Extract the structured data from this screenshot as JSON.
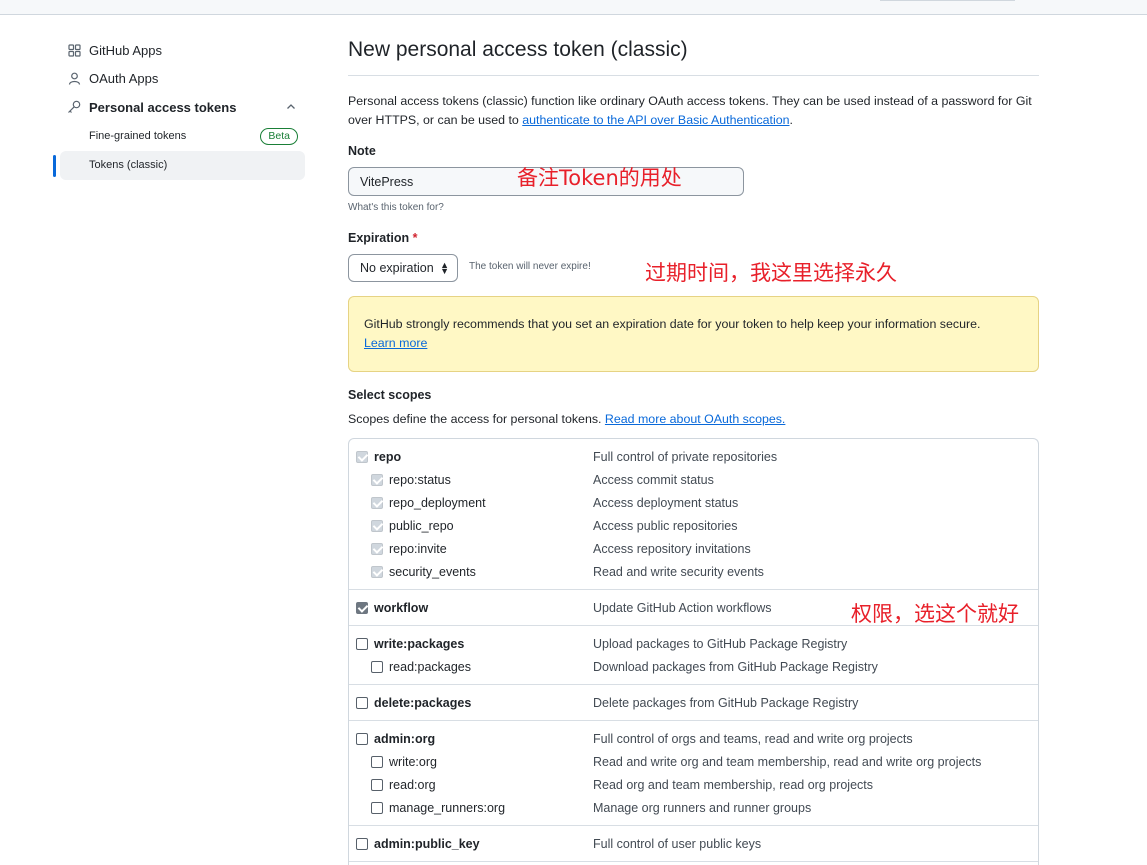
{
  "sidebar": {
    "items": [
      {
        "label": "GitHub Apps",
        "icon": "apps-grid-icon"
      },
      {
        "label": "OAuth Apps",
        "icon": "person-icon"
      },
      {
        "label": "Personal access tokens",
        "icon": "key-icon"
      }
    ],
    "sub_items": [
      {
        "label": "Fine-grained tokens",
        "badge": "Beta"
      },
      {
        "label": "Tokens (classic)",
        "active": true
      }
    ]
  },
  "main": {
    "title": "New personal access token (classic)",
    "desc_text": "Personal access tokens (classic) function like ordinary OAuth access tokens. They can be used instead of a password for Git over HTTPS, or can be used to ",
    "desc_link": "authenticate to the API over Basic Authentication",
    "desc_end": ".",
    "note": {
      "label": "Note",
      "value": "VitePress",
      "hint": "What's this token for?"
    },
    "expiration": {
      "label": "Expiration",
      "required": "*",
      "value": "No expiration",
      "hint": "The token will never expire!"
    },
    "warning": {
      "text": "GitHub strongly recommends that you set an expiration date for your token to help keep your information secure.",
      "link": "Learn more"
    },
    "scopes": {
      "label": "Select scopes",
      "desc": "Scopes define the access for personal tokens. ",
      "desc_link": "Read more about OAuth scopes.",
      "groups": [
        {
          "rows": [
            {
              "name": "repo",
              "desc": "Full control of private repositories",
              "state": "disabled",
              "level": "parent"
            },
            {
              "name": "repo:status",
              "desc": "Access commit status",
              "state": "disabled",
              "level": "child"
            },
            {
              "name": "repo_deployment",
              "desc": "Access deployment status",
              "state": "disabled",
              "level": "child"
            },
            {
              "name": "public_repo",
              "desc": "Access public repositories",
              "state": "disabled",
              "level": "child"
            },
            {
              "name": "repo:invite",
              "desc": "Access repository invitations",
              "state": "disabled",
              "level": "child"
            },
            {
              "name": "security_events",
              "desc": "Read and write security events",
              "state": "disabled",
              "level": "child"
            }
          ]
        },
        {
          "rows": [
            {
              "name": "workflow",
              "desc": "Update GitHub Action workflows",
              "state": "checked",
              "level": "parent"
            }
          ]
        },
        {
          "rows": [
            {
              "name": "write:packages",
              "desc": "Upload packages to GitHub Package Registry",
              "state": "unchecked",
              "level": "parent"
            },
            {
              "name": "read:packages",
              "desc": "Download packages from GitHub Package Registry",
              "state": "unchecked",
              "level": "child"
            }
          ]
        },
        {
          "rows": [
            {
              "name": "delete:packages",
              "desc": "Delete packages from GitHub Package Registry",
              "state": "unchecked",
              "level": "parent"
            }
          ]
        },
        {
          "rows": [
            {
              "name": "admin:org",
              "desc": "Full control of orgs and teams, read and write org projects",
              "state": "unchecked",
              "level": "parent"
            },
            {
              "name": "write:org",
              "desc": "Read and write org and team membership, read and write org projects",
              "state": "unchecked",
              "level": "child"
            },
            {
              "name": "read:org",
              "desc": "Read org and team membership, read org projects",
              "state": "unchecked",
              "level": "child"
            },
            {
              "name": "manage_runners:org",
              "desc": "Manage org runners and runner groups",
              "state": "unchecked",
              "level": "child"
            }
          ]
        },
        {
          "rows": [
            {
              "name": "admin:public_key",
              "desc": "Full control of user public keys",
              "state": "unchecked",
              "level": "parent"
            }
          ]
        }
      ]
    }
  },
  "annotations": {
    "note": "备注Token的用处",
    "expiration": "过期时间，我这里选择永久",
    "scopes": "权限，选这个就好"
  },
  "colors": {
    "accent": "#0969da",
    "annotation": "#e8202a",
    "warning_bg": "#fff8c5",
    "beta": "#1a7f37"
  }
}
